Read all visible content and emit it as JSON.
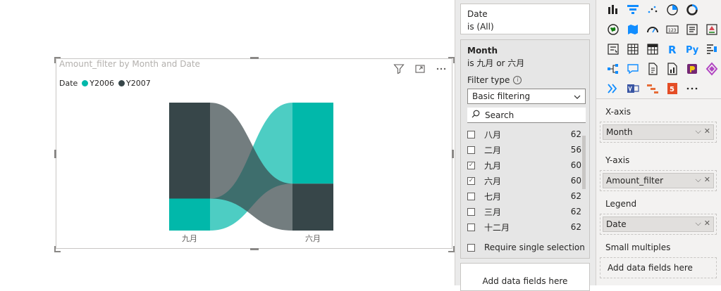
{
  "visual": {
    "title": "Amount_filter by Month and Date",
    "legend_title": "Date",
    "legend_items": [
      {
        "label": "Y2006",
        "color": "#01b8aa"
      },
      {
        "label": "Y2007",
        "color": "#374649"
      }
    ],
    "toolbar_icons": [
      "filter-icon",
      "focus-mode-icon",
      "more-options-icon"
    ]
  },
  "chart_data": {
    "type": "ribbon",
    "categories": [
      "九月",
      "六月"
    ],
    "series": [
      {
        "name": "Y2006",
        "color": "#01b8aa",
        "values": [
          15,
          38
        ]
      },
      {
        "name": "Y2007",
        "color": "#374649",
        "values": [
          45,
          22
        ]
      }
    ]
  },
  "filters": {
    "date_card": {
      "field": "Date",
      "state": "is (All)"
    },
    "month_card": {
      "field": "Month",
      "state": "is 九月 or 六月",
      "filter_type_label": "Filter type",
      "filter_type_value": "Basic filtering",
      "search_placeholder": "Search",
      "items": [
        {
          "label": "八月",
          "count": "62",
          "checked": false
        },
        {
          "label": "二月",
          "count": "56",
          "checked": false
        },
        {
          "label": "九月",
          "count": "60",
          "checked": true
        },
        {
          "label": "六月",
          "count": "60",
          "checked": true
        },
        {
          "label": "七月",
          "count": "62",
          "checked": false
        },
        {
          "label": "三月",
          "count": "62",
          "checked": false
        },
        {
          "label": "十二月",
          "count": "62",
          "checked": false
        }
      ],
      "require_single_selection": "Require single selection"
    },
    "add_fields": "Add data fields here"
  },
  "viz_pane": {
    "xaxis_label": "X-axis",
    "xaxis_field": "Month",
    "yaxis_label": "Y-axis",
    "yaxis_field": "Amount_filter",
    "legend_label": "Legend",
    "legend_field": "Date",
    "small_multiples_label": "Small multiples",
    "small_multiples_placeholder": "Add data fields here",
    "icon_names": [
      "stacked-column-chart-icon",
      "funnel-chart-icon",
      "scatter-chart-icon",
      "pie-chart-icon",
      "donut-chart-icon",
      "",
      "map-icon",
      "filled-map-icon",
      "gauge-icon",
      "card-icon",
      "multi-row-card-icon",
      "kpi-icon",
      "slicer-icon",
      "table-icon",
      "matrix-icon",
      "r-visual-icon",
      "python-visual-icon",
      "key-influencers-icon",
      "decomposition-tree-icon",
      "qa-icon",
      "smart-narrative-icon",
      "paginated-report-icon",
      "power-apps-icon",
      "power-automate-icon",
      "more-visuals-icon",
      "visio-icon",
      "gantt-icon",
      "html-icon",
      "more-options-icon",
      ""
    ]
  }
}
